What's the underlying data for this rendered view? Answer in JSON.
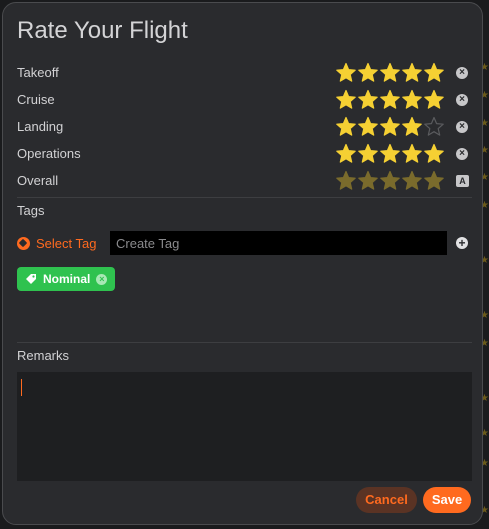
{
  "dialog": {
    "title": "Rate Your Flight"
  },
  "ratings": [
    {
      "label": "Takeoff",
      "value": 5,
      "max": 5,
      "style": "filled",
      "action": "clear"
    },
    {
      "label": "Cruise",
      "value": 5,
      "max": 5,
      "style": "filled",
      "action": "clear"
    },
    {
      "label": "Landing",
      "value": 4,
      "max": 5,
      "style": "filled",
      "action": "clear"
    },
    {
      "label": "Operations",
      "value": 5,
      "max": 5,
      "style": "filled",
      "action": "clear"
    },
    {
      "label": "Overall",
      "value": 5,
      "max": 5,
      "style": "auto",
      "action": "auto",
      "badge": "A"
    }
  ],
  "tags": {
    "section_label": "Tags",
    "select_label": "Select Tag",
    "create_placeholder": "Create Tag",
    "create_value": "",
    "chips": [
      {
        "label": "Nominal",
        "color": "#2fc24f"
      }
    ]
  },
  "remarks": {
    "section_label": "Remarks",
    "value": ""
  },
  "buttons": {
    "cancel_label": "Cancel",
    "save_label": "Save"
  },
  "colors": {
    "accent": "#ff6a1f",
    "star_filled": "#f5d033",
    "star_auto": "#7a6b2c",
    "star_empty": "#4a4b4e",
    "chip_green": "#2fc24f",
    "panel_bg": "#2a2b2e"
  },
  "icons": {
    "star": "star-icon",
    "clear": "clear-circle-icon",
    "auto": "auto-badge-icon",
    "select_tag": "tag-circle-icon",
    "add_tag": "plus-circle-icon",
    "chip_tag": "tag-icon",
    "chip_remove": "remove-circle-icon"
  }
}
